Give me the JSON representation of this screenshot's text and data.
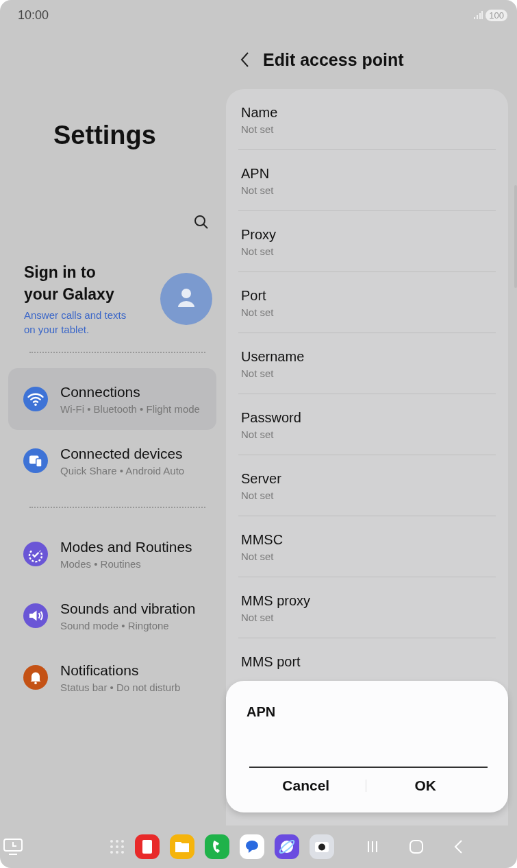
{
  "status_bar": {
    "time": "10:00",
    "battery": "100"
  },
  "settings": {
    "title": "Settings",
    "account": {
      "title": "Sign in to your Galaxy",
      "subtitle": "Answer calls and texts on your tablet."
    },
    "groups": [
      [
        {
          "title": "Connections",
          "subtitle": "Wi-Fi  •  Bluetooth  •  Flight mode",
          "selected": true,
          "color": "#3e73d6"
        },
        {
          "title": "Connected devices",
          "subtitle": "Quick Share  •  Android Auto",
          "selected": false,
          "color": "#3e73d6"
        }
      ],
      [
        {
          "title": "Modes and Routines",
          "subtitle": "Modes  •  Routines",
          "selected": false,
          "color": "#6a56d6"
        },
        {
          "title": "Sounds and vibration",
          "subtitle": "Sound mode  •  Ringtone",
          "selected": false,
          "color": "#6a56d6"
        },
        {
          "title": "Notifications",
          "subtitle": "Status bar  •  Do not disturb",
          "selected": false,
          "color": "#c45215"
        }
      ]
    ]
  },
  "detail": {
    "title": "Edit access point",
    "fields": [
      {
        "label": "Name",
        "value": "Not set"
      },
      {
        "label": "APN",
        "value": "Not set"
      },
      {
        "label": "Proxy",
        "value": "Not set"
      },
      {
        "label": "Port",
        "value": "Not set"
      },
      {
        "label": "Username",
        "value": "Not set"
      },
      {
        "label": "Password",
        "value": "Not set"
      },
      {
        "label": "Server",
        "value": "Not set"
      },
      {
        "label": "MMSC",
        "value": "Not set"
      },
      {
        "label": "MMS proxy",
        "value": "Not set"
      },
      {
        "label": "MMS port"
      }
    ]
  },
  "dialog": {
    "title": "APN",
    "buttons": [
      "Cancel",
      "OK"
    ]
  }
}
